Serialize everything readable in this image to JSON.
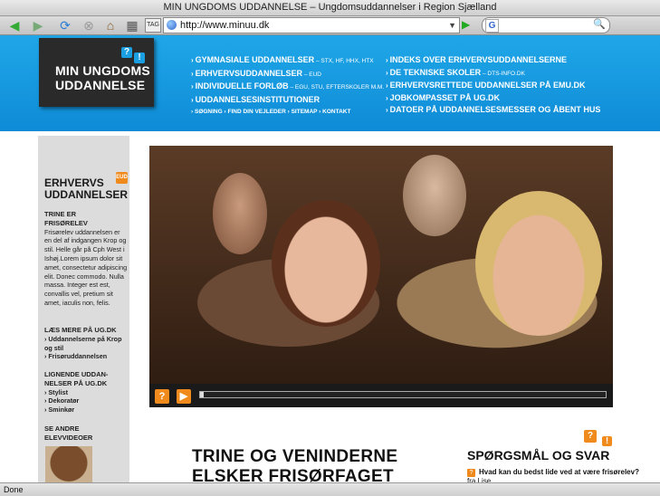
{
  "window": {
    "title": "MIN UNGDOMS UDDANNELSE – Ungdomsuddannelser i Region Sjælland"
  },
  "toolbar": {
    "url": "http://www.minuu.dk",
    "tag_label": "TAG",
    "search_placeholder": "",
    "search_engine_label": "G"
  },
  "logo": {
    "line1": "MIN UNGDOMS",
    "line2": "UDDANNELSE"
  },
  "nav": {
    "left": [
      {
        "label": "GYMNASIALE UDDANNELSER",
        "sub": " – STX, HF, HHX, HTX"
      },
      {
        "label": "ERHVERVSUDDANNELSER",
        "sub": " – EUD"
      },
      {
        "label": "INDIVIDUELLE FORLØB",
        "sub": " – EGU, STU, EFTERSKOLER M.M."
      },
      {
        "label": "UDDANNELSESINSTITUTIONER",
        "sub": ""
      }
    ],
    "small": [
      "SØGNING",
      "FIND DIN VEJLEDER",
      "SITEMAP",
      "KONTAKT"
    ],
    "right": [
      {
        "label": "INDEKS OVER ERHVERVSUDDANNELSERNE",
        "sub": ""
      },
      {
        "label": "DE TEKNISKE SKOLER",
        "sub": " – DTS-INFO.DK"
      },
      {
        "label": "ERHVERVSRETTEDE UDDANNELSER PÅ EMU.DK",
        "sub": ""
      },
      {
        "label": "JOBKOMPASSET PÅ UG.DK",
        "sub": ""
      },
      {
        "label": "DATOER PÅ UDDANNELSESMESSER OG ÅBENT HUS",
        "sub": ""
      }
    ]
  },
  "sidebar": {
    "heading1": "ERHVERVS",
    "heading2": "UDDANNELSER",
    "badge": "EUD",
    "story_title1": "TRINE ER",
    "story_title2": "FRISØRELEV",
    "story_text": "Frisørelev uddannelsen er en del af indgangen Krop og stil. Helle går på Cph West i Ishøj.Lorem ipsum dolor sit amet, consectetur adipiscing elit. Donec commodo. Nulla massa. Integer est est, convallis vel, pretium sit amet, iaculis non, felis.",
    "read_more_title": "LÆS MERE PÅ UG.DK",
    "read_more_links": [
      "Uddannelserne på Krop og stil",
      "Frisøruddannelsen"
    ],
    "similar_title": "LIGNENDE UDDAN-NELSER PÅ UG.DK",
    "similar_links": [
      "Stylist",
      "Dekoratør",
      "Sminkør"
    ],
    "other_videos_title": "SE ANDRE ELEVVIDEOER"
  },
  "video": {
    "progress": 0.01
  },
  "article": {
    "title": "TRINE OG VENINDERNE ELSKER FRISØRFAGET"
  },
  "faq": {
    "title": "SPØRGSMÅL OG SVAR",
    "question": "Hvad kan du bedst lide ved at være frisørelev?",
    "author": " fra Lise"
  },
  "status": {
    "text": "Done"
  },
  "colors": {
    "header_blue": "#1a9fe3",
    "accent_orange": "#f08a1c",
    "logo_bg": "#2a2a2a"
  }
}
